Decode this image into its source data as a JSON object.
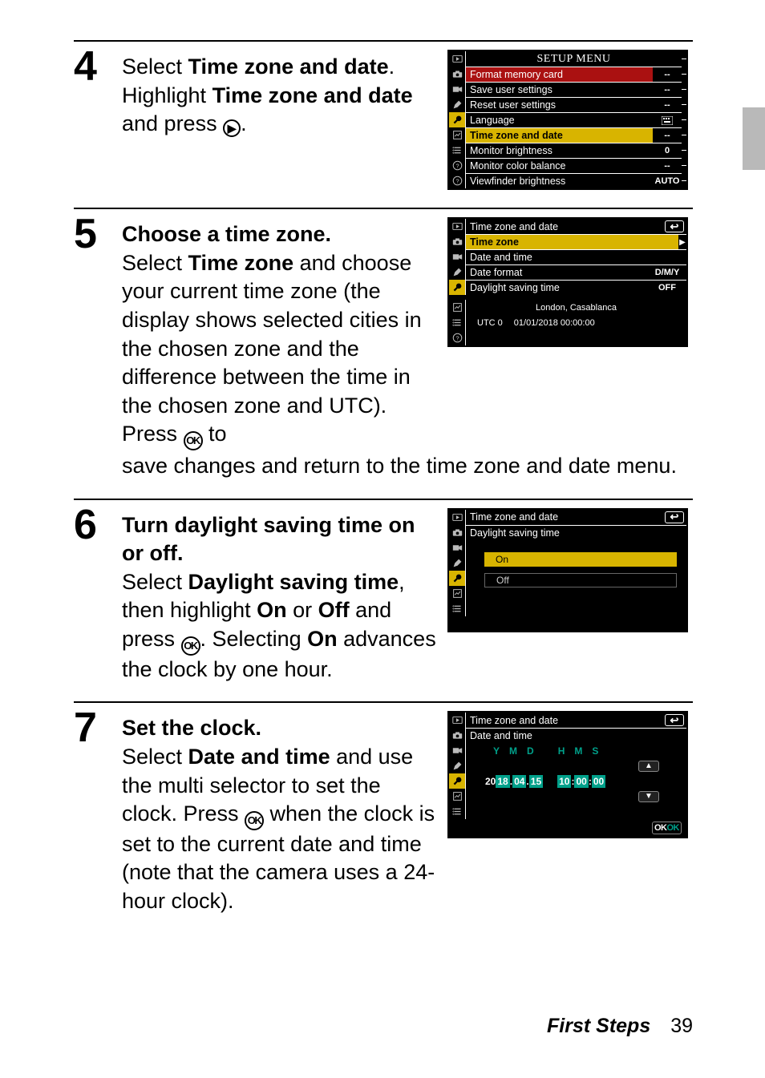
{
  "footer": {
    "section": "First Steps",
    "page": "39"
  },
  "steps": {
    "s4": {
      "num": "4",
      "title_pre": "Select ",
      "title_bold": "Time zone and date",
      "title_post": ".",
      "line2_pre": "Highlight ",
      "line2_bold": "Time zone and date",
      "line2_post": " and press ",
      "right_icon": "▶",
      "period": "."
    },
    "s5": {
      "num": "5",
      "title": "Choose a time zone.",
      "l1a": "Select ",
      "l1b": "Time zone",
      "l1c": " and choose your current time zone (the display shows selected cities in the chosen zone and the difference between the time in the chosen zone and UTC). Press ",
      "ok": "J",
      "l1d": " to",
      "after": "save changes and return to the time zone and date menu."
    },
    "s6": {
      "num": "6",
      "title": "Turn daylight saving time on or off.",
      "l1a": "Select ",
      "l1b": "Daylight saving time",
      "l1c": ", then highlight ",
      "on": "On",
      "or": " or ",
      "off": "Off",
      "l1d": " and press ",
      "l1e": ". Selecting ",
      "on2": "On",
      "l1f": " advances the clock by one hour."
    },
    "s7": {
      "num": "7",
      "title": "Set the clock.",
      "l1a": "Select ",
      "l1b": "Date and time",
      "l1c": " and use the multi selector to set the clock. Press ",
      "l1d": " when the clock is set to the current date and time (note that the camera uses a 24-hour clock)."
    }
  },
  "lcd_setup": {
    "title": "SETUP MENU",
    "items": [
      {
        "label": "Format memory card",
        "val": "--",
        "hl": "red"
      },
      {
        "label": "Save user settings",
        "val": "--"
      },
      {
        "label": "Reset user settings",
        "val": "--"
      },
      {
        "label": "Language",
        "val": "",
        "icon": "keyboard"
      },
      {
        "label": "Time zone and date",
        "val": "--",
        "sel": true
      },
      {
        "label": "Monitor brightness",
        "val": "0"
      },
      {
        "label": "Monitor color balance",
        "val": "--"
      },
      {
        "label": "Viewfinder brightness",
        "val": "AUTO"
      }
    ]
  },
  "lcd_tz": {
    "title": "Time zone and date",
    "rows": [
      {
        "label": "Time zone",
        "sel": true,
        "arrow": true
      },
      {
        "label": "Date and time"
      },
      {
        "label": "Date format",
        "val": "D/M/Y"
      },
      {
        "label": "Daylight saving time",
        "val": "OFF"
      }
    ],
    "city": "London, Casablanca",
    "utc": "UTC  0",
    "stamp": "01/01/2018 00:00:00"
  },
  "lcd_dst": {
    "title": "Time zone and date",
    "sub": "Daylight saving time",
    "on": "On",
    "off": "Off"
  },
  "lcd_dt": {
    "title": "Time zone and date",
    "sub": "Date and time",
    "hdr": [
      "Y",
      "M",
      "D",
      "H",
      "M",
      "S"
    ],
    "y_pre": "20",
    "y": "18",
    "m": "04",
    "d": "15",
    "h": "10",
    "mi": "00",
    "s": "00",
    "up": "▲",
    "down": "▼",
    "ok": "OK"
  },
  "chart_data": {
    "type": "table",
    "title": "Camera menu screenshots depicted in figure",
    "screens": [
      {
        "name": "SETUP MENU",
        "rows": [
          [
            "Format memory card",
            "--"
          ],
          [
            "Save user settings",
            "--"
          ],
          [
            "Reset user settings",
            "--"
          ],
          [
            "Language",
            "(keyboard icon)"
          ],
          [
            "Time zone and date",
            "--"
          ],
          [
            "Monitor brightness",
            "0"
          ],
          [
            "Monitor color balance",
            "--"
          ],
          [
            "Viewfinder brightness",
            "AUTO"
          ]
        ],
        "highlighted_row": "Time zone and date"
      },
      {
        "name": "Time zone and date",
        "rows": [
          [
            "Time zone",
            "(selected, ▶)"
          ],
          [
            "Date and time",
            ""
          ],
          [
            "Date format",
            "D/M/Y"
          ],
          [
            "Daylight saving time",
            "OFF"
          ]
        ],
        "footer": [
          "London, Casablanca",
          "UTC 0",
          "01/01/2018 00:00:00"
        ]
      },
      {
        "name": "Time zone and date › Daylight saving time",
        "options": [
          "On",
          "Off"
        ],
        "selected": "On"
      },
      {
        "name": "Time zone and date › Date and time",
        "fields": {
          "Y": "2018",
          "M": "04",
          "D": "15",
          "H": "10",
          "Mi": "00",
          "S": "00"
        },
        "controls": [
          "▲",
          "▼",
          "OK"
        ]
      }
    ]
  }
}
